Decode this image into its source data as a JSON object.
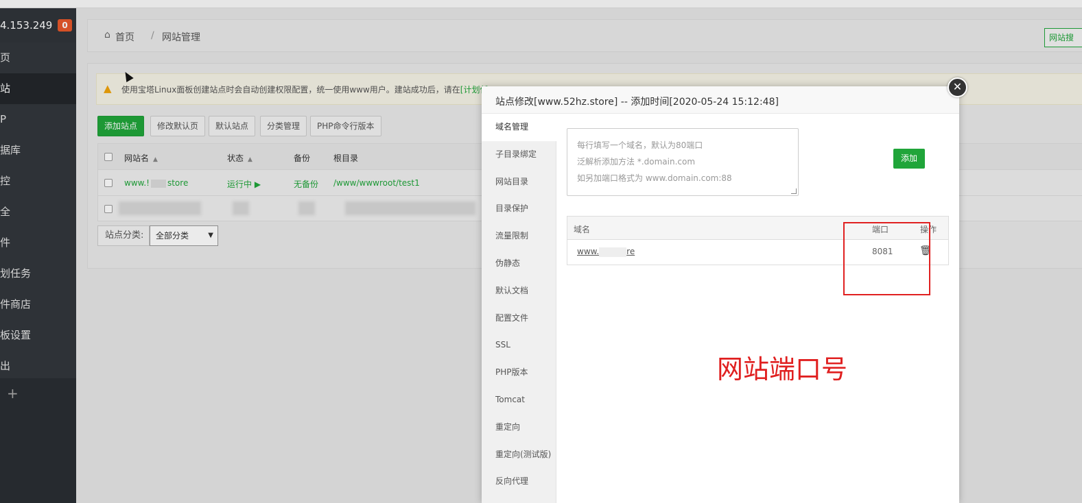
{
  "sidebar": {
    "ip": "4.153.249",
    "badge": "0",
    "items": [
      {
        "label": "页",
        "active": false
      },
      {
        "label": "站",
        "active": true
      },
      {
        "label": "P",
        "active": false
      },
      {
        "label": "据库",
        "active": false
      },
      {
        "label": "控",
        "active": false
      },
      {
        "label": "全",
        "active": false
      },
      {
        "label": "件",
        "active": false
      },
      {
        "label": "划任务",
        "active": false
      },
      {
        "label": "件商店",
        "active": false
      },
      {
        "label": "板设置",
        "active": false
      },
      {
        "label": "出",
        "active": false
      }
    ],
    "add_icon": "+"
  },
  "breadcrumb": {
    "home": "首页",
    "separator": "/",
    "current": "网站管理",
    "search_button": "网站搜"
  },
  "notice": {
    "text": "使用宝塔Linux面板创建站点时会自动创建权限配置，统一使用www用户。建站成功后，请在",
    "link": "[计划任"
  },
  "toolbar": {
    "add_site": "添加站点",
    "modify_default_page": "修改默认页",
    "default_site": "默认站点",
    "category_manage": "分类管理",
    "php_cli_version": "PHP命令行版本"
  },
  "sites_table": {
    "headers": {
      "name": "网站名",
      "status": "状态",
      "backup": "备份",
      "root": "根目录"
    },
    "rows": [
      {
        "name_prefix": "www.!",
        "name_suffix": "store",
        "status": "运行中 ▶",
        "backup": "无备份",
        "root": "/www/wwwroot/test1"
      }
    ]
  },
  "category": {
    "label": "站点分类:",
    "selected": "全部分类"
  },
  "modal": {
    "title": "站点修改[www.52hz.store] -- 添加时间[2020-05-24 15:12:48]",
    "close": "✕",
    "tabs": [
      "域名管理",
      "子目录绑定",
      "网站目录",
      "目录保护",
      "流量限制",
      "伪静态",
      "默认文档",
      "配置文件",
      "SSL",
      "PHP版本",
      "Tomcat",
      "重定向",
      "重定向(测试版)",
      "反向代理"
    ],
    "active_tab": "域名管理",
    "textarea_placeholder_lines": [
      "每行填写一个域名，默认为80端口",
      "泛解析添加方法 *.domain.com",
      "如另加端口格式为 www.domain.com:88"
    ],
    "add_button": "添加",
    "domain_table": {
      "headers": {
        "domain": "域名",
        "port": "端口",
        "action": "操作"
      },
      "rows": [
        {
          "domain_prefix": "www.",
          "domain_suffix": "re",
          "port": "8081"
        }
      ]
    }
  },
  "annotation": {
    "text": "网站端口号",
    "color": "#e02020"
  },
  "colors": {
    "accent_green": "#20a53a",
    "sidebar_bg": "#32373c",
    "badge": "#e8572a"
  }
}
